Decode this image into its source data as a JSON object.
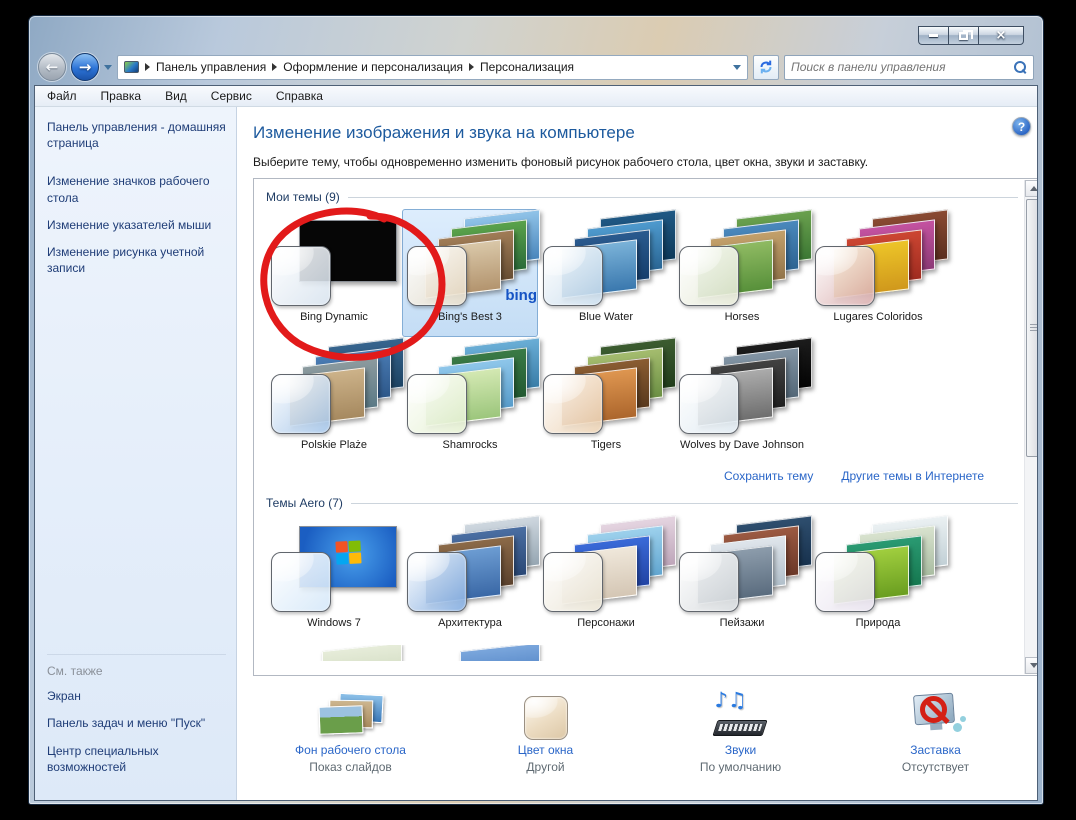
{
  "address_bar": {
    "breadcrumb": [
      "Панель управления",
      "Оформление и персонализация",
      "Персонализация"
    ],
    "search_placeholder": "Поиск в панели управления"
  },
  "menu_bar": {
    "items": [
      "Файл",
      "Правка",
      "Вид",
      "Сервис",
      "Справка"
    ]
  },
  "sidebar": {
    "home_link": "Панель управления - домашняя страница",
    "links": [
      "Изменение значков рабочего стола",
      "Изменение указателей мыши",
      "Изменение рисунка учетной записи"
    ],
    "see_also": {
      "header": "См. также",
      "links": [
        "Экран",
        "Панель задач и меню \"Пуск\"",
        "Центр специальных возможностей"
      ]
    }
  },
  "main": {
    "title": "Изменение изображения и звука на компьютере",
    "subtitle": "Выберите тему, чтобы одновременно изменить фоновый рисунок рабочего стола, цвет окна, звуки и заставку.",
    "groups": {
      "my_themes": "Мои темы (9)",
      "aero_themes": "Темы Aero (7)"
    },
    "my_themes": [
      "Bing Dynamic",
      "Bing's Best 3",
      "Blue Water",
      "Horses",
      "Lugares Coloridos",
      "Polskie Plaże",
      "Shamrocks",
      "Tigers",
      "Wolves by Dave Johnson"
    ],
    "aero_themes": [
      "Windows 7",
      "Архитектура",
      "Персонажи",
      "Пейзажи",
      "Природа"
    ],
    "selected_theme": "Bing's Best 3",
    "bing_logo": "bing",
    "links": {
      "save_theme": "Сохранить тему",
      "more_themes": "Другие темы в Интернете"
    }
  },
  "bottom_bar": {
    "items": [
      {
        "label": "Фон рабочего стола",
        "status": "Показ слайдов"
      },
      {
        "label": "Цвет окна",
        "status": "Другой"
      },
      {
        "label": "Звуки",
        "status": "По умолчанию"
      },
      {
        "label": "Заставка",
        "status": "Отсутствует"
      }
    ]
  },
  "colors": {
    "heading_blue": "#1d5a9e",
    "link_blue": "#2a66c8",
    "sidebar_link": "#1f3d77",
    "annotation_red": "#e21a1a",
    "selection_border": "#84aed6",
    "selection_fill": "#d9eafc"
  }
}
